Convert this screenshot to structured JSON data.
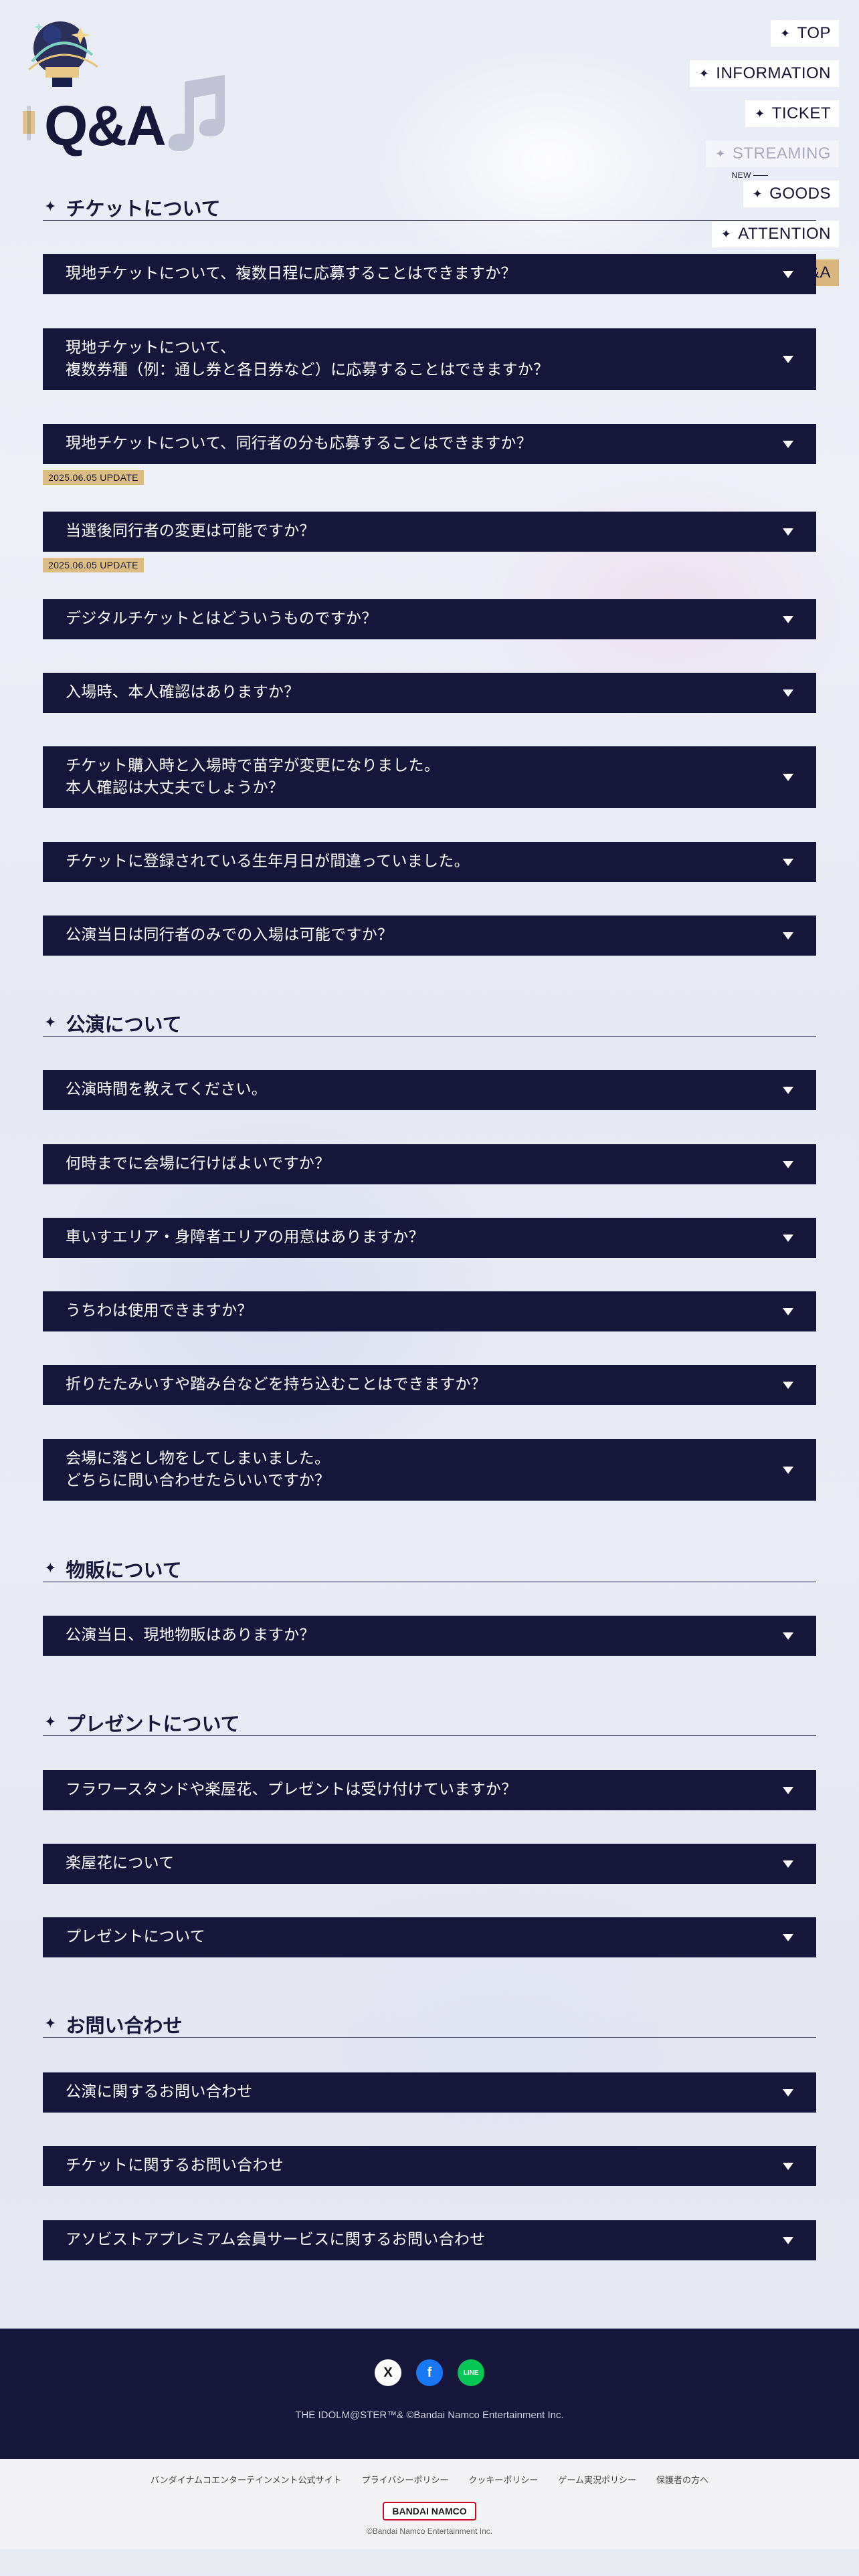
{
  "header": {
    "title": "Q&A"
  },
  "nav": {
    "items": [
      {
        "label": "TOP"
      },
      {
        "label": "INFORMATION"
      },
      {
        "label": "TICKET"
      },
      {
        "label": "STREAMING",
        "state": "disabled"
      },
      {
        "label": "GOODS",
        "badge": "NEW"
      },
      {
        "label": "ATTENTION"
      },
      {
        "label": "Q&A",
        "state": "active"
      }
    ]
  },
  "sections": {
    "ticket": {
      "heading": "チケットについて",
      "items": [
        {
          "question": "現地チケットについて、複数日程に応募することはできますか？"
        },
        {
          "question": "現地チケットについて、\n複数券種（例：通し券と各日券など）に応募することはできますか？"
        },
        {
          "question": "現地チケットについて、同行者の分も応募することはできますか？"
        },
        {
          "question": "当選後同行者の変更は可能ですか？",
          "badge": "2025.06.05 UPDATE"
        },
        {
          "question": "デジタルチケットとはどういうものですか？",
          "badge": "2025.06.05 UPDATE"
        },
        {
          "question": "入場時、本人確認はありますか？"
        },
        {
          "question": "チケット購入時と入場時で苗字が変更になりました。\n本人確認は大丈夫でしょうか？"
        },
        {
          "question": "チケットに登録されている生年月日が間違っていました。"
        },
        {
          "question": "公演当日は同行者のみでの入場は可能ですか？"
        }
      ]
    },
    "performance": {
      "heading": "公演について",
      "items": [
        {
          "question": "公演時間を教えてください。"
        },
        {
          "question": "何時までに会場に行けばよいですか？"
        },
        {
          "question": "車いすエリア・身障者エリアの用意はありますか？"
        },
        {
          "question": "うちわは使用できますか？"
        },
        {
          "question": "折りたたみいすや踏み台などを持ち込むことはできますか？"
        },
        {
          "question": "会場に落とし物をしてしまいました。\nどちらに問い合わせたらいいですか？"
        }
      ]
    },
    "merch": {
      "heading": "物販について",
      "items": [
        {
          "question": "公演当日、現地物販はありますか？"
        }
      ]
    },
    "present": {
      "heading": "プレゼントについて",
      "items": [
        {
          "question": "フラワースタンドや楽屋花、プレゼントは受け付けていますか？"
        },
        {
          "question": "楽屋花について"
        },
        {
          "question": "プレゼントについて"
        }
      ]
    },
    "contact": {
      "heading": "お問い合わせ",
      "items": [
        {
          "question": "公演に関するお問い合わせ"
        },
        {
          "question": "チケットに関するお問い合わせ"
        },
        {
          "question": "アソビストアプレミアム会員サービスに関するお問い合わせ"
        }
      ]
    }
  },
  "footer": {
    "sns": [
      {
        "icon": "x-icon",
        "glyph": "X"
      },
      {
        "icon": "facebook-icon",
        "glyph": "f"
      },
      {
        "icon": "line-icon",
        "glyph": "LINE"
      }
    ],
    "copyright_dark": "THE IDOLM@STER™& ©Bandai Namco Entertainment Inc.",
    "links": [
      {
        "label": "バンダイナムコエンターテインメント公式サイト"
      },
      {
        "label": "プライバシーポリシー"
      },
      {
        "label": "クッキーポリシー"
      },
      {
        "label": "ゲーム実況ポリシー"
      },
      {
        "label": "保護者の方へ"
      }
    ],
    "logo_text": "BANDAI NAMCO",
    "copyright_light": "©Bandai Namco Entertainment Inc."
  },
  "colors": {
    "accent_gold": "#d9b77c",
    "navy": "#15163a"
  }
}
